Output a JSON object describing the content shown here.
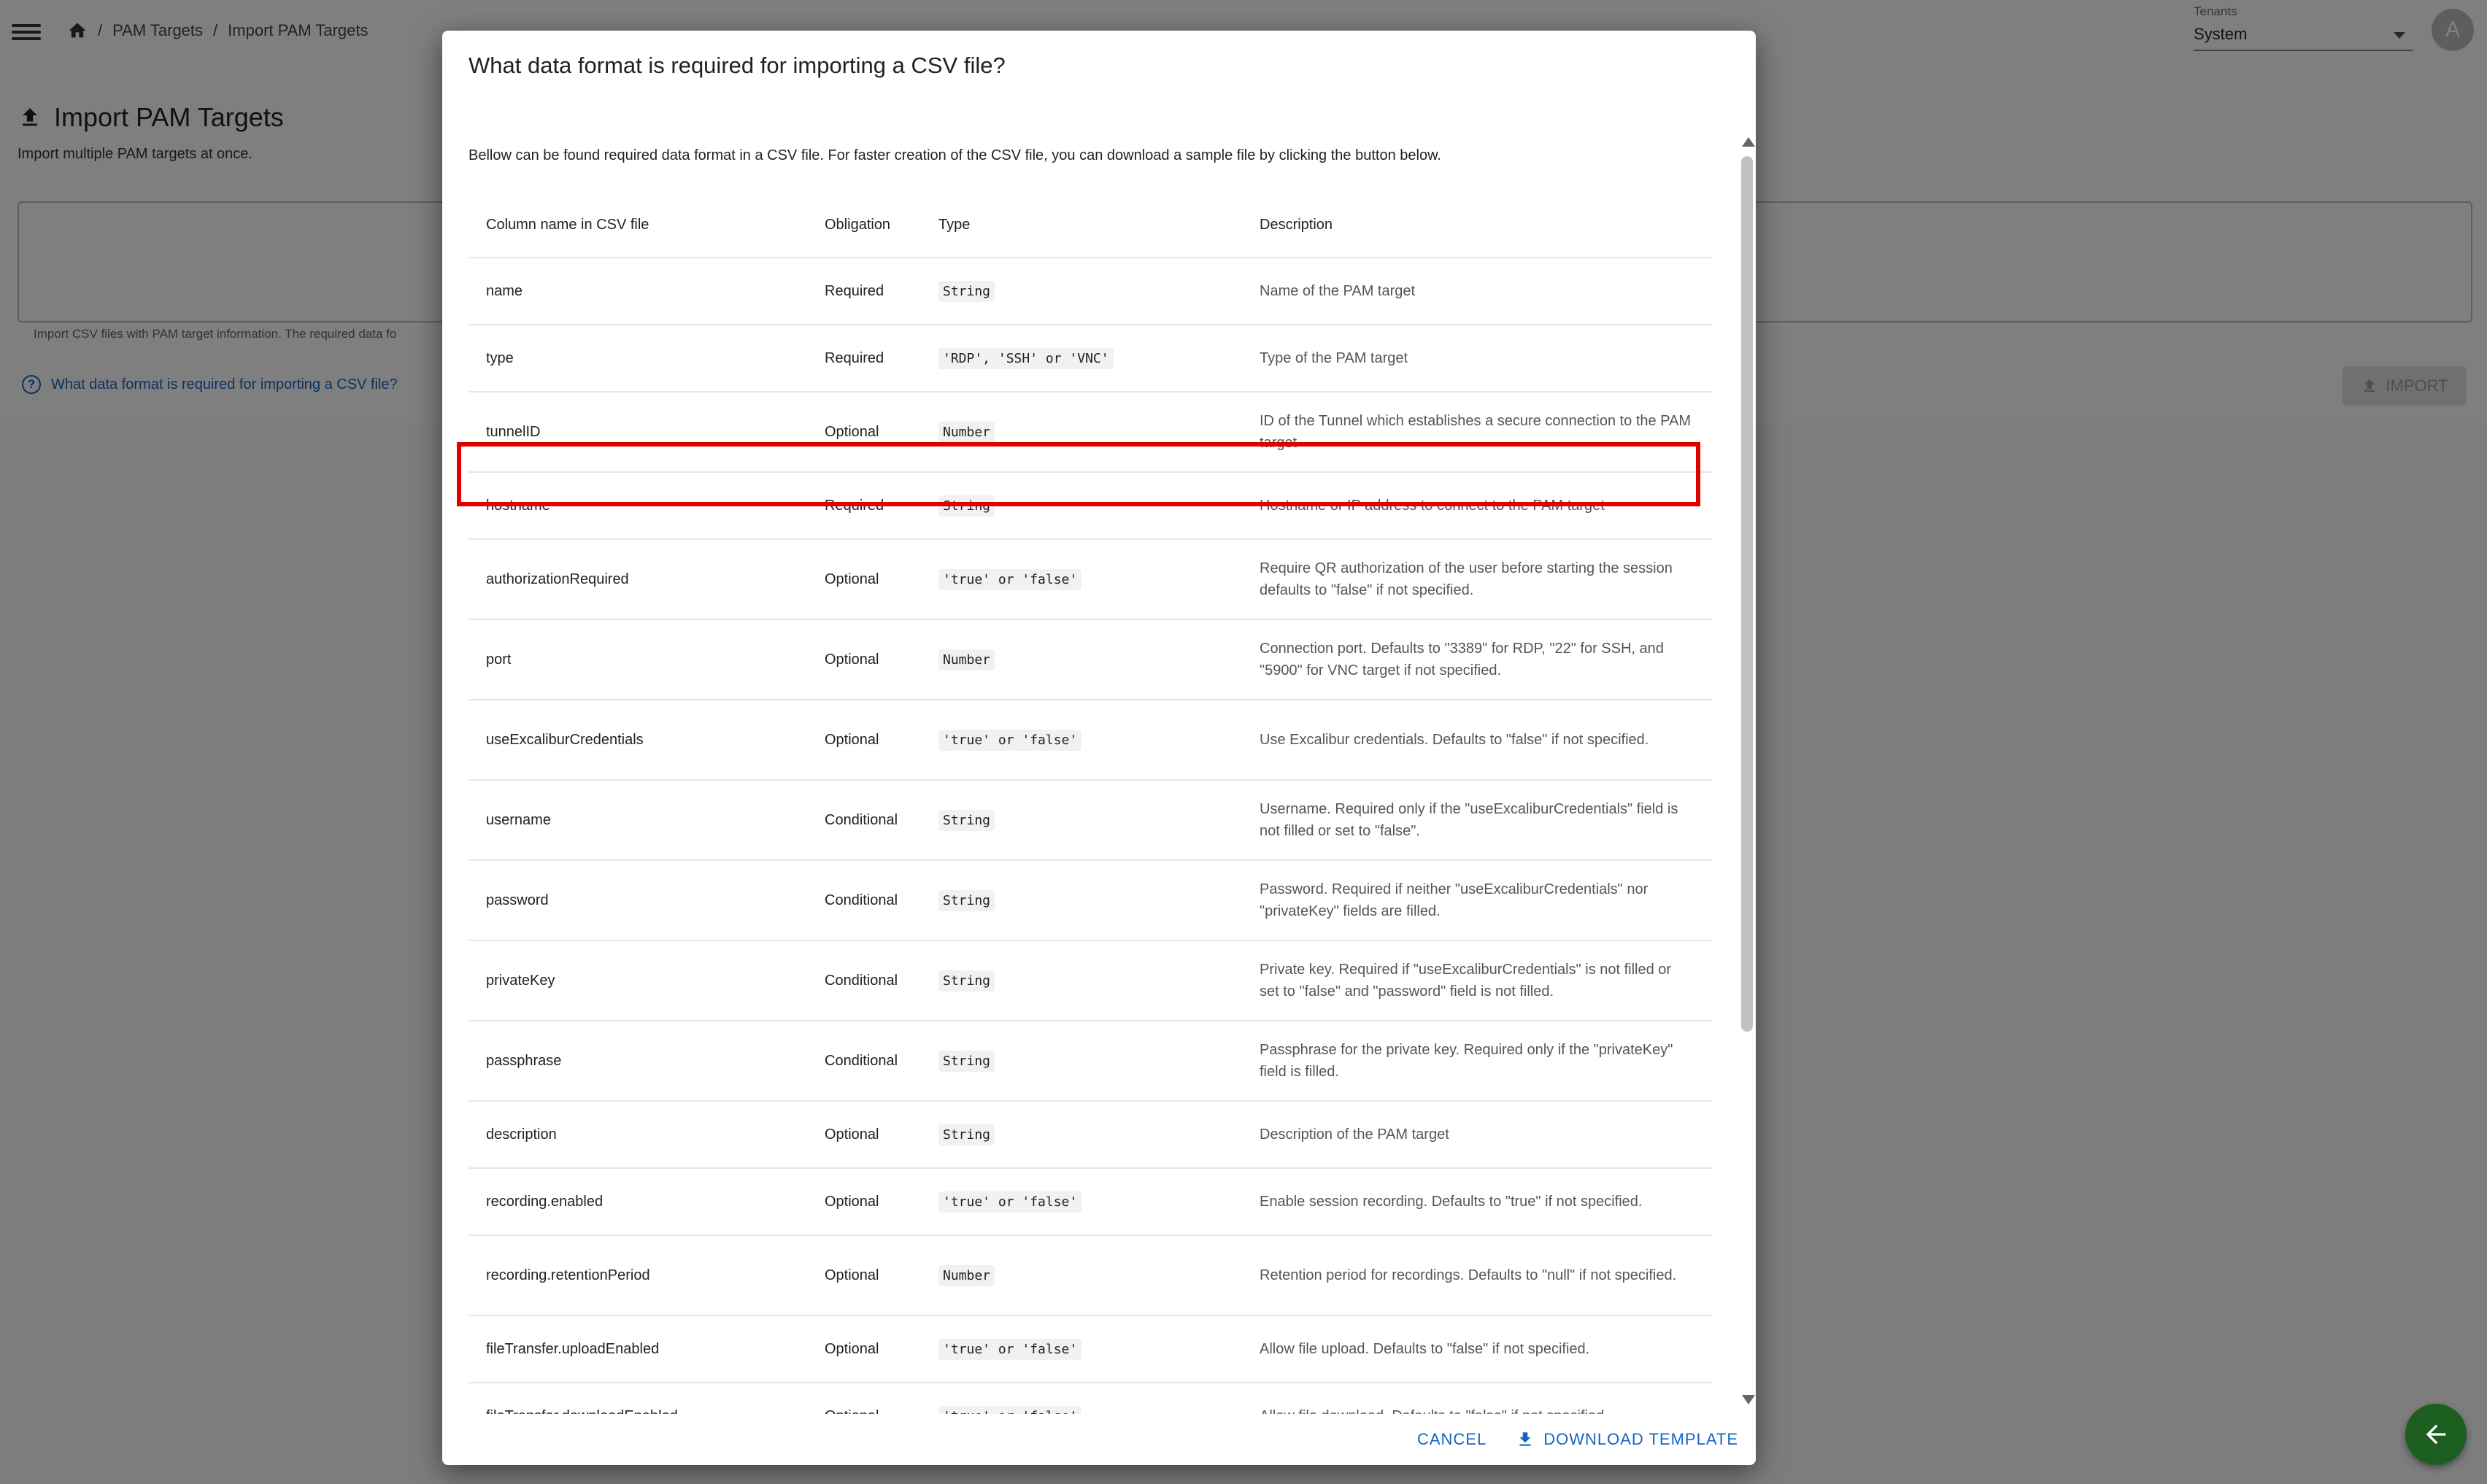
{
  "breadcrumb": {
    "items": [
      "PAM Targets",
      "Import PAM Targets"
    ]
  },
  "tenant": {
    "label": "Tenants",
    "value": "System"
  },
  "avatar": {
    "initial": "A"
  },
  "page": {
    "title": "Import PAM Targets",
    "subtitle": "Import multiple PAM targets at once.",
    "drop_help": "Import CSV files with PAM target information. The required data fo",
    "help_link": "What data format is required for importing a CSV file?",
    "import_label": "IMPORT"
  },
  "dialog": {
    "title": "What data format is required for importing a CSV file?",
    "intro": "Bellow can be found required data format in a CSV file. For faster creation of the CSV file, you can download a sample file by clicking the button below.",
    "columns": [
      "Column name in CSV file",
      "Obligation",
      "Type",
      "Description"
    ],
    "rows": [
      {
        "name": "name",
        "obligation": "Required",
        "type": "String",
        "description": "Name of the PAM target"
      },
      {
        "name": "type",
        "obligation": "Required",
        "type": "'RDP', 'SSH' or 'VNC'",
        "description": "Type of the PAM target"
      },
      {
        "name": "tunnelID",
        "obligation": "Optional",
        "type": "Number",
        "description": "ID of the Tunnel which establishes a secure connection to the PAM target"
      },
      {
        "name": "hostname",
        "obligation": "Required",
        "type": "String",
        "description": "Hostname or IP address to connect to the PAM target"
      },
      {
        "name": "authorizationRequired",
        "obligation": "Optional",
        "type": "'true' or 'false'",
        "description": "Require QR authorization of the user before starting the session defaults to \"false\" if not specified."
      },
      {
        "name": "port",
        "obligation": "Optional",
        "type": "Number",
        "description": "Connection port. Defaults to \"3389\" for RDP, \"22\" for SSH, and \"5900\" for VNC target if not specified."
      },
      {
        "name": "useExcaliburCredentials",
        "obligation": "Optional",
        "type": "'true' or 'false'",
        "description": "Use Excalibur credentials. Defaults to \"false\" if not specified."
      },
      {
        "name": "username",
        "obligation": "Conditional",
        "type": "String",
        "description": "Username. Required only if the \"useExcaliburCredentials\" field is not filled or set to \"false\"."
      },
      {
        "name": "password",
        "obligation": "Conditional",
        "type": "String",
        "description": "Password. Required if neither \"useExcaliburCredentials\" nor \"privateKey\" fields are filled."
      },
      {
        "name": "privateKey",
        "obligation": "Conditional",
        "type": "String",
        "description": "Private key. Required if \"useExcaliburCredentials\" is not filled or set to \"false\" and \"password\" field is not filled."
      },
      {
        "name": "passphrase",
        "obligation": "Conditional",
        "type": "String",
        "description": "Passphrase for the private key. Required only if the \"privateKey\" field is filled."
      },
      {
        "name": "description",
        "obligation": "Optional",
        "type": "String",
        "description": "Description of the PAM target"
      },
      {
        "name": "recording.enabled",
        "obligation": "Optional",
        "type": "'true' or 'false'",
        "description": "Enable session recording. Defaults to \"true\" if not specified."
      },
      {
        "name": "recording.retentionPeriod",
        "obligation": "Optional",
        "type": "Number",
        "description": "Retention period for recordings. Defaults to \"null\" if not specified."
      },
      {
        "name": "fileTransfer.uploadEnabled",
        "obligation": "Optional",
        "type": "'true' or 'false'",
        "description": "Allow file upload. Defaults to \"false\" if not specified."
      },
      {
        "name": "fileTransfer.downloadEnabled",
        "obligation": "Optional",
        "type": "'true' or 'false'",
        "description": "Allow file download. Defaults to \"false\" if not specified."
      }
    ],
    "cancel_label": "CANCEL",
    "download_label": "DOWNLOAD TEMPLATE"
  },
  "colors": {
    "required": "#c62828",
    "optional": "#666666",
    "conditional": "#e65100",
    "accent": "#1565c0",
    "highlight": "#e00000",
    "fab": "#1b5e20"
  }
}
